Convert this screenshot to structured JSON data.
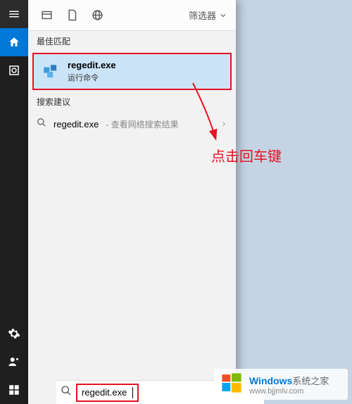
{
  "taskbar": {
    "hamburger": "菜单",
    "home": "主页",
    "recent": "最近"
  },
  "header": {
    "filter_label": "筛选器"
  },
  "sections": {
    "best_match": "最佳匹配",
    "suggestions": "搜索建议"
  },
  "best_match": {
    "title": "regedit.exe",
    "subtitle": "运行命令"
  },
  "suggestion": {
    "main": "regedit.exe",
    "sub": " - 查看网络搜索结果"
  },
  "annotation": {
    "text": "点击回车键"
  },
  "search_input": {
    "value": "regedit.exe"
  },
  "watermark": {
    "brand": "Windows",
    "suffix": "系统之家",
    "url": "www.bjjmlv.com"
  },
  "colors": {
    "accent": "#0078d7",
    "highlight_border": "#e81123",
    "selection_bg": "#cce4f7"
  }
}
